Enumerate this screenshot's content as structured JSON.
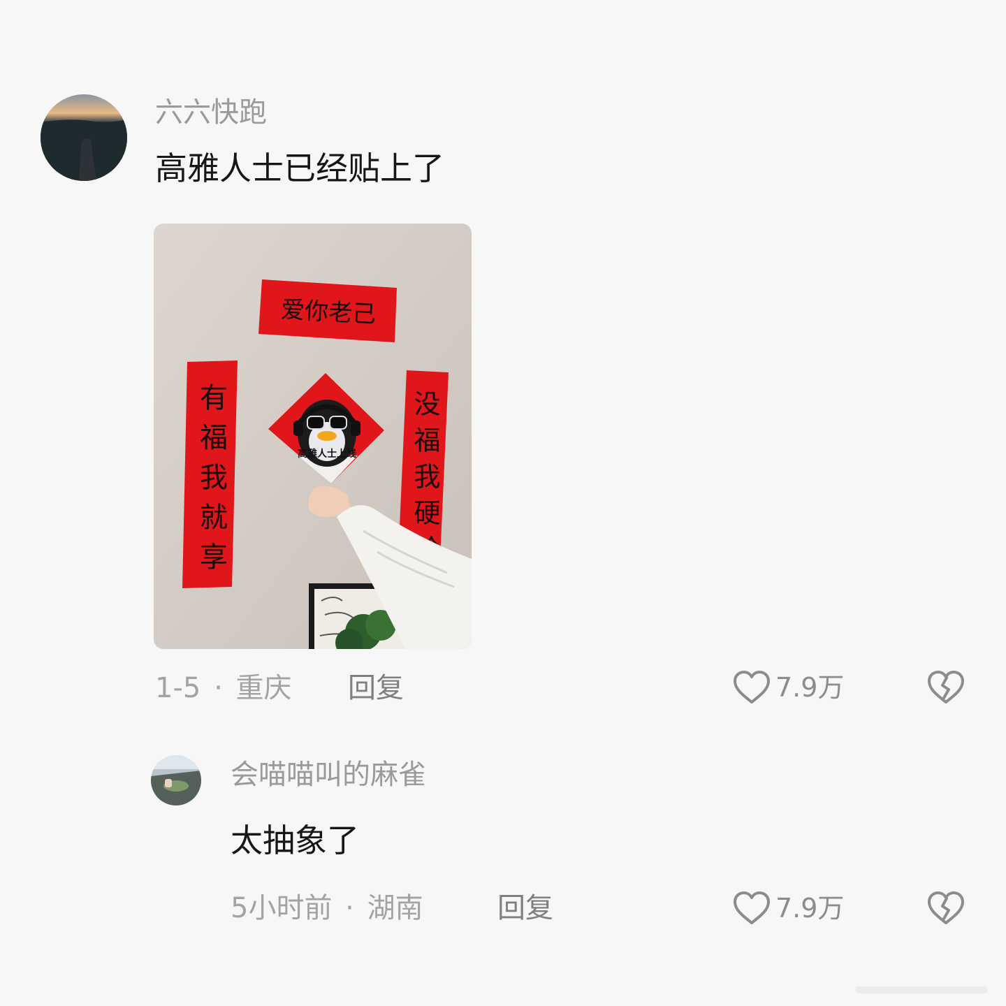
{
  "comments": [
    {
      "username": "六六快跑",
      "text": "高雅人士已经贴上了",
      "date": "1-5",
      "separator": "·",
      "location": "重庆",
      "reply_label": "回复",
      "like_count": "7.9万",
      "image": {
        "horizontal_scroll": "爱你老己",
        "left_couplet": "有福我就享",
        "right_couplet": "没福我硬抢",
        "diamond_caption": "高雅人士上线"
      }
    },
    {
      "username": "会喵喵叫的麻雀",
      "text": "太抽象了",
      "date": "5小时前",
      "separator": "·",
      "location": "湖南",
      "reply_label": "回复",
      "like_count": "7.9万"
    }
  ],
  "icons": {
    "like": "heart-outline-icon",
    "dislike": "broken-heart-icon"
  },
  "colors": {
    "background": "#f7f7f7",
    "couplet_red": "#e0161b",
    "username": "#9a9a9a",
    "comment_text": "#161616",
    "meta": "#a3a3a3"
  }
}
